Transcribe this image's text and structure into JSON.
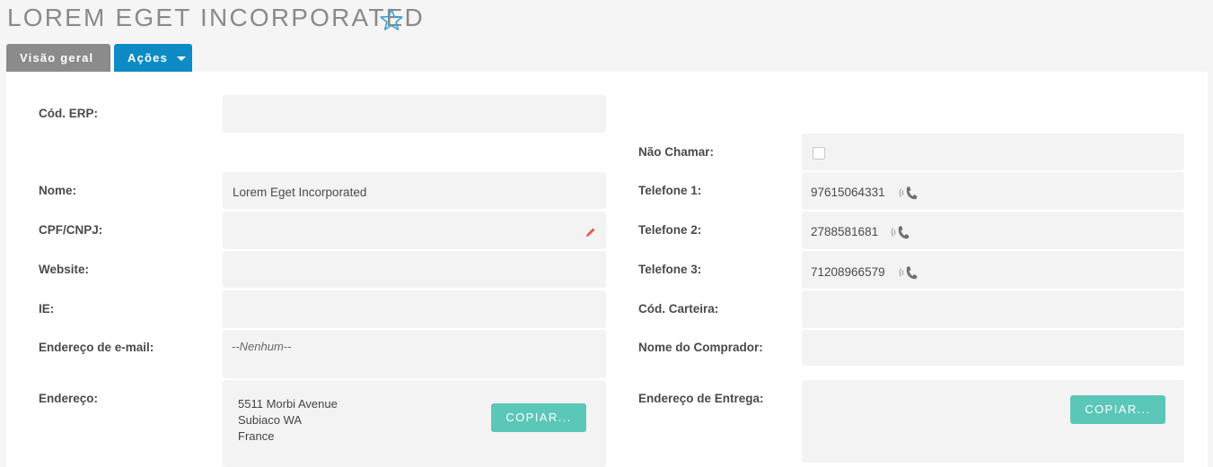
{
  "record": {
    "title": "LOREM EGET INCORPORATED"
  },
  "tabs": {
    "overview": "Visão geral",
    "actions": "Ações"
  },
  "fields": {
    "erp_code": {
      "label": "Cód. ERP:",
      "value": ""
    },
    "do_not_call": {
      "label": "Não Chamar:",
      "checked": false
    },
    "name": {
      "label": "Nome:",
      "value": "Lorem Eget Incorporated"
    },
    "phone1": {
      "label": "Telefone 1:",
      "value": "97615064331"
    },
    "cpf_cnpj": {
      "label": "CPF/CNPJ:",
      "value": ""
    },
    "phone2": {
      "label": "Telefone 2:",
      "value": "2788581681"
    },
    "website": {
      "label": "Website:",
      "value": ""
    },
    "phone3": {
      "label": "Telefone 3:",
      "value": "71208966579"
    },
    "ie": {
      "label": "IE:",
      "value": ""
    },
    "wallet_code": {
      "label": "Cód. Carteira:",
      "value": ""
    },
    "email": {
      "label": "Endereço de e-mail:",
      "value": "--Nenhum--"
    },
    "buyer_name": {
      "label": "Nome do Comprador:",
      "value": ""
    },
    "address": {
      "label": "Endereço:",
      "line1": "5511 Morbi Avenue",
      "line2": "Subiaco WA",
      "line3": "France"
    },
    "shipping_address": {
      "label": "Endereço de Entrega:"
    }
  },
  "buttons": {
    "copy": "COPIAR..."
  },
  "colors": {
    "accent_blue": "#0e8bc5",
    "copy_teal": "#5bc7b9",
    "tab_gray": "#8b8b8b",
    "star": "#3a9fd8",
    "edit_pencil": "#e8594f"
  },
  "icons": {
    "favorite": "star-outline-icon",
    "call": "phone-icon",
    "edit": "pencil-icon",
    "dropdown": "caret-down-icon"
  }
}
